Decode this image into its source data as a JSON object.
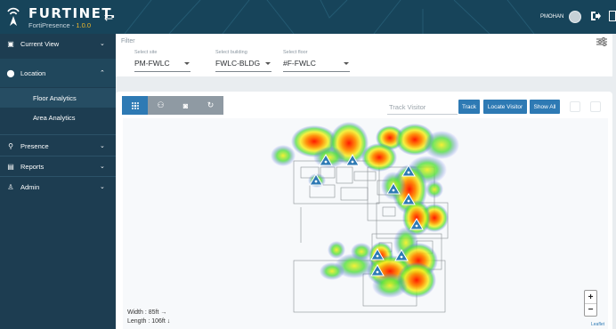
{
  "brand": {
    "name": "FURTINET.",
    "product": "FortiPresence - ",
    "version": "1.0.0"
  },
  "user": {
    "name": "PMOHAN"
  },
  "sidebar": {
    "items": [
      {
        "label": "Current View",
        "icon": "monitor-icon",
        "chevron": "⌄"
      },
      {
        "label": "Location",
        "icon": "location-pin-icon",
        "chevron": "⌃"
      },
      {
        "label": "Presence",
        "icon": "presence-icon",
        "chevron": "⌄"
      },
      {
        "label": "Reports",
        "icon": "reports-icon",
        "chevron": "⌄"
      },
      {
        "label": "Admin",
        "icon": "user-icon",
        "chevron": "⌄"
      }
    ],
    "subitems": [
      {
        "label": "Floor Analytics",
        "active": true
      },
      {
        "label": "Area Analytics",
        "active": false
      }
    ]
  },
  "filter": {
    "label": "Filter",
    "site": {
      "caption": "Select site",
      "value": "PM-FWLC"
    },
    "building": {
      "caption": "Select building",
      "value": "FWLC-BLDG"
    },
    "floor": {
      "caption": "Select floor",
      "value": "#F-FWLC"
    }
  },
  "map": {
    "track_placeholder": "Track Visitor",
    "buttons": {
      "track": "Track",
      "locate": "Locate Visitor",
      "show_all": "Show All"
    },
    "width_label": "Width : 85ft →",
    "length_label": "Length : 106ft ↓",
    "zoom_in": "+",
    "zoom_out": "−",
    "attribution": "Leaflet"
  },
  "colors": {
    "accent": "#2e7ab4",
    "sidebar": "#1d3d51",
    "topbar": "#17445a",
    "version": "#f0b92b"
  }
}
